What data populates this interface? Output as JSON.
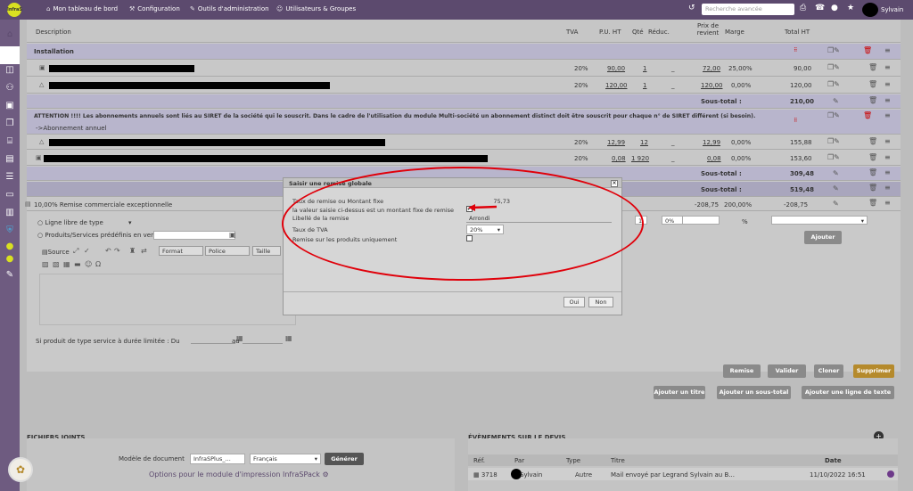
{
  "topbar": {
    "logo": "InfraS",
    "nav": [
      "Mon tableau de bord",
      "Configuration",
      "Outils d'administration",
      "Utilisateurs & Groupes"
    ],
    "search_placeholder": "Recherche avancée",
    "user": "Sylvain"
  },
  "table": {
    "headers": {
      "description": "Description",
      "tva": "TVA",
      "pu": "P.U. HT",
      "qty": "Qté",
      "reduc": "Réduc.",
      "prix_revient": "Prix de revient",
      "marge": "Marge",
      "total": "Total HT"
    },
    "installation_title": "Installation",
    "rows": [
      {
        "tva": "20%",
        "pu": "90,00",
        "qty": "1",
        "reduc": "_",
        "prix": "72,00",
        "marge": "25,00%",
        "total": "90,00"
      },
      {
        "tva": "20%",
        "pu": "120,00",
        "qty": "1",
        "reduc": "_",
        "prix": "120,00",
        "marge": "0,00%",
        "total": "120,00"
      }
    ],
    "subtotal_label": "Sous-total :",
    "subtotal1": "210,00",
    "attention_text": "ATTENTION !!!! Les abonnements annuels sont liés au SIRET de la société qui le souscrit. Dans le cadre de l'utilisation du module Multi-société un abonnement distinct doit être souscrit pour chaque n° de SIRET différent (si besoin).",
    "abonnement": "->Abonnement annuel",
    "rows2": [
      {
        "tva": "20%",
        "pu": "12,99",
        "qty": "12",
        "reduc": "_",
        "prix": "12,99",
        "marge": "0,00%",
        "total": "155,88"
      },
      {
        "tva": "20%",
        "pu": "0,08",
        "qty": "1 920",
        "reduc": "_",
        "prix": "0,08",
        "marge": "0,00%",
        "total": "153,60"
      }
    ],
    "subtotal2": "309,48",
    "subtotal3": "519,48",
    "remise_row": {
      "label": "10,00% Remise commerciale exceptionnelle",
      "prix": "-208,75",
      "marge": "200,00%",
      "total": "-208,75"
    }
  },
  "addline": {
    "free_line": "Ligne libre de type",
    "predefined": "Produits/Services prédéfinis en vente",
    "source": "Source",
    "format": "Format",
    "police": "Police",
    "taille": "Taille",
    "qty": "1",
    "pct": "0%",
    "pct2": "%",
    "ajouter": "Ajouter",
    "service_label": "Si produit de type service à durée limitée : Du",
    "au": "au"
  },
  "modal": {
    "title": "Saisir une remise globale",
    "label1": "Taux de remise ou Montant fixe",
    "value1": "75,73",
    "label2": "la valeur saisie ci-dessus est un montant fixe de remise",
    "label3": "Libellé de la remise",
    "value3": "Arrondi",
    "label4": "Taux de TVA",
    "value4": "20%",
    "label5": "Remise sur les produits uniquement",
    "oui": "Oui",
    "non": "Non"
  },
  "actions": {
    "remise": "Remise",
    "valider": "Valider",
    "cloner": "Cloner",
    "supprimer": "Supprimer",
    "ajouter_titre": "Ajouter un titre",
    "ajouter_sous_total": "Ajouter un sous-total",
    "ajouter_ligne_texte": "Ajouter une ligne de texte"
  },
  "files": {
    "title": "FICHIERS JOINTS",
    "model_label": "Modèle de document",
    "model_value": "InfraSPlus_...",
    "lang": "Français",
    "generer": "Générer",
    "options": "Options pour le module d'impression InfraSPack"
  },
  "events": {
    "title": "ÉVÈNEMENTS SUR LE DEVIS",
    "cols": [
      "Réf.",
      "Par",
      "Type",
      "Titre",
      "Date"
    ],
    "row": {
      "ref": "3718",
      "par": "Sylvain",
      "type": "Autre",
      "titre": "Mail envoyé par Legrand Sylvain au B...",
      "date": "11/10/2022 16:51"
    }
  },
  "colors": {
    "topbar": "#5c4a6e",
    "sidebar": "#6e5b80",
    "section": "#b8b5cc",
    "highlight": "#e0000a",
    "accent": "#b58a2c"
  }
}
